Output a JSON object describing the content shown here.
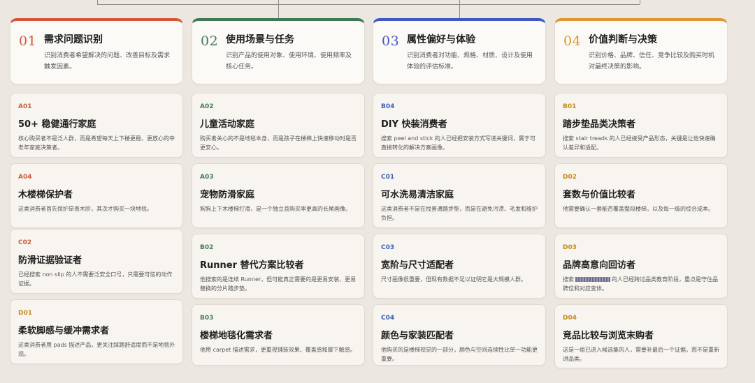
{
  "colors": {
    "red": "#d6563b",
    "green": "#3f7a55",
    "blue": "#3f57c0",
    "orange": "#e09532",
    "codeA": "#c85a3e",
    "codeB": "#3b5fb8",
    "codeC": "#c85a3e",
    "codeD": "#c8891e"
  },
  "columns": [
    {
      "num": "01",
      "title": "需求问题识别",
      "desc": "识别消费者希望解决的问题、改善目标及需求触发因素。",
      "cards": [
        {
          "code": "A01",
          "title": "50+ 稳健通行家庭",
          "desc": "核心购买者不是泛人群，而是希望每天上下楼更稳、更放心的中老年家庭决策者。"
        },
        {
          "code": "A04",
          "title": "木楼梯保护者",
          "desc": "这类消费者首先保护昂贵木阶，其次才购买一块地毯。"
        },
        {
          "code": "C02",
          "title": "防滑证据验证者",
          "desc": "已经搜索 non slip 的人不需要泛安全口号，只需要可信的动作证据。"
        },
        {
          "code": "D01",
          "title": "柔软脚感与缓冲需求者",
          "desc": "这类消费者用 pads 描述产品，更关注踩踏舒适度而不是地毯外观。"
        }
      ]
    },
    {
      "num": "02",
      "title": "使用场景与任务",
      "desc": "识别产品的使用对象、使用环境、使用频率及核心任务。",
      "cards": [
        {
          "code": "A02",
          "title": "儿童活动家庭",
          "desc": "购买者关心的不是地毯本身，而是孩子在楼梯上快速移动时是否更安心。"
        },
        {
          "code": "A03",
          "title": "宠物防滑家庭",
          "desc": "狗狗上下木楼梯打滑，是一个独立且购买率更高的长尾画像。"
        },
        {
          "code": "B02",
          "title": "Runner 替代方案比较者",
          "desc": "他搜索的是连续 Runner，但可能真正需要的是更易安装、更易替换的分片踏步垫。"
        },
        {
          "code": "B03",
          "title": "楼梯地毯化需求者",
          "desc": "他用 carpet 描述需求，更重视铺装效果、覆盖感和脚下触感。"
        }
      ]
    },
    {
      "num": "03",
      "title": "属性偏好与体验",
      "desc": "识别消费者对功能、规格、材质、设计及使用体验的评估标准。",
      "cards": [
        {
          "code": "B04",
          "title": "DIY 快装消费者",
          "desc": "搜索 peel and stick 的人已经把安装方式写进关键词，属于可直接转化的解决方案画像。"
        },
        {
          "code": "C01",
          "title": "可水洗易清洁家庭",
          "desc": "这类消费者不是在找普通踏步垫，而是在避免污渍、毛发和维护负担。"
        },
        {
          "code": "C03",
          "title": "宽阶与尺寸适配者",
          "desc": "尺寸画像很重要，但现有数据不足以证明它是大规模人群。"
        },
        {
          "code": "C04",
          "title": "颜色与家装匹配者",
          "desc": "他购买的是楼梯视觉的一部分，颜色与空间连续性比单一功能更重要。"
        }
      ]
    },
    {
      "num": "04",
      "title": "价值判断与决策",
      "desc": "识别价格、品牌、信任、竞争比较及购买时机对最终决策的影响。",
      "cards": [
        {
          "code": "B01",
          "title": "踏步垫品类决策者",
          "desc": "搜索 stair treads 的人已经接受产品形态，关键是让他快速确认差异和适配。"
        },
        {
          "code": "D02",
          "title": "套数与价值比较者",
          "desc": "他需要确认一套能否覆盖整段楼梯，以及每一级的综合成本。"
        },
        {
          "code": "D03",
          "title": "品牌高意向回访者",
          "desc_pre": "搜索",
          "desc": "的人已经跨过品类教育阶段，重点是守住品牌位和对应变体。"
        },
        {
          "code": "D04",
          "title": "竞品比较与浏览末购者",
          "desc": "这是一组已进入候选集的人，需要补最后一个证据，而不是重新讲品类。"
        }
      ]
    }
  ]
}
